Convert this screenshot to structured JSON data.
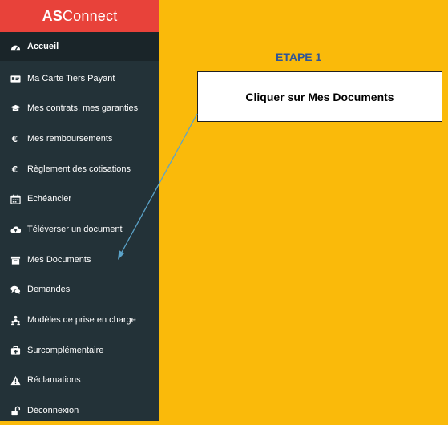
{
  "logo": {
    "bold": "AS",
    "regular": "Connect"
  },
  "sidebar": {
    "items": [
      {
        "label": "Accueil",
        "icon": "dashboard-icon"
      },
      {
        "label": "Ma Carte Tiers Payant",
        "icon": "id-card-icon"
      },
      {
        "label": "Mes contrats, mes garanties",
        "icon": "graduation-cap-icon"
      },
      {
        "label": "Mes remboursements",
        "icon": "euro-icon"
      },
      {
        "label": "Règlement des cotisations",
        "icon": "euro-icon"
      },
      {
        "label": "Echéancier",
        "icon": "calendar-icon"
      },
      {
        "label": "Téléverser un document",
        "icon": "cloud-upload-icon"
      },
      {
        "label": "Mes Documents",
        "icon": "archive-icon"
      },
      {
        "label": "Demandes",
        "icon": "comments-icon"
      },
      {
        "label": "Modèles de prise en charge",
        "icon": "sitemap-icon"
      },
      {
        "label": "Surcomplémentaire",
        "icon": "medkit-icon"
      },
      {
        "label": "Réclamations",
        "icon": "warning-icon"
      },
      {
        "label": "Déconnexion",
        "icon": "unlock-icon"
      }
    ]
  },
  "step": {
    "title": "ETAPE 1"
  },
  "callout": {
    "text": "Cliquer sur Mes Documents"
  },
  "colors": {
    "background": "#FABA0A",
    "sidebar": "#233238",
    "logo_bar": "#E8423A",
    "step_title": "#2F5597",
    "arrow": "#5BA3C9"
  }
}
